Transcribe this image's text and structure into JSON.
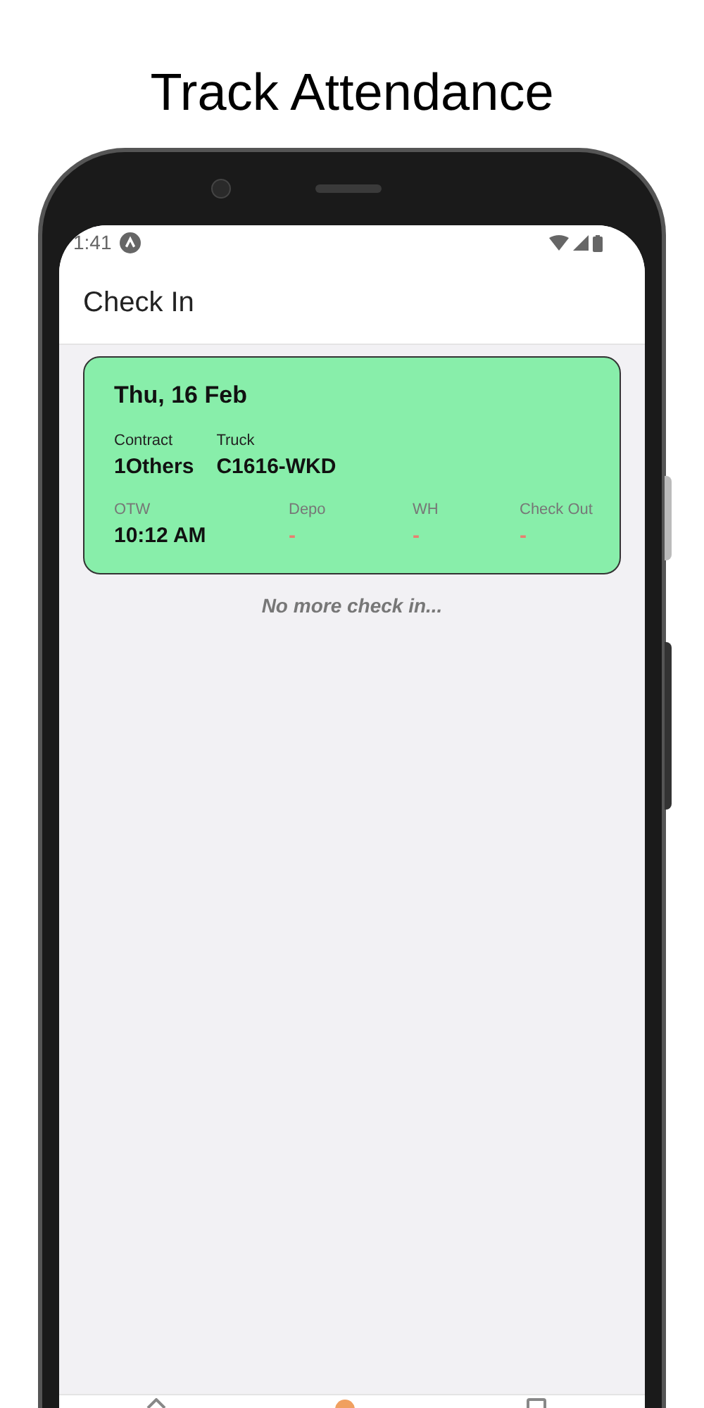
{
  "caption": "Track Attendance",
  "status_bar": {
    "time": "1:41"
  },
  "app_bar": {
    "title": "Check In"
  },
  "check_ins": [
    {
      "date": "Thu, 16 Feb",
      "fields": [
        {
          "label": "Contract",
          "value": "1Others"
        },
        {
          "label": "Truck",
          "value": "C1616-WKD"
        }
      ],
      "stages": [
        {
          "label": "OTW",
          "value": "10:12 AM",
          "recorded": true
        },
        {
          "label": "Depo",
          "value": "-",
          "recorded": false
        },
        {
          "label": "WH",
          "value": "-",
          "recorded": false
        },
        {
          "label": "Check Out",
          "value": "-",
          "recorded": false
        }
      ]
    }
  ],
  "end_message": "No more check in..."
}
